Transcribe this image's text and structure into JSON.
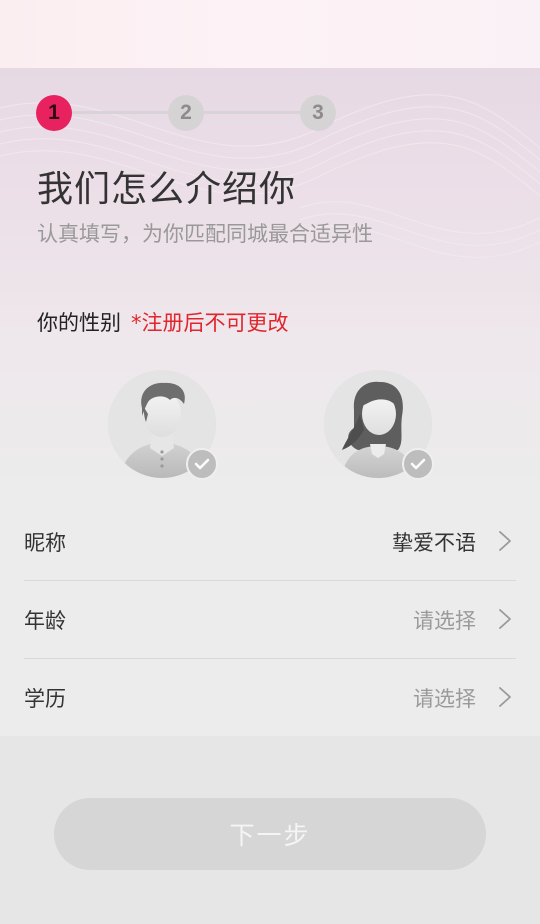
{
  "steps": [
    {
      "number": "1",
      "state": "active"
    },
    {
      "number": "2",
      "state": "inactive"
    },
    {
      "number": "3",
      "state": "inactive"
    }
  ],
  "header": {
    "title": "我们怎么介绍你",
    "subtitle": "认真填写，为你匹配同城最合适异性"
  },
  "gender": {
    "label": "你的性别",
    "note": "*注册后不可更改",
    "options": [
      {
        "name": "male",
        "icon": "male-avatar-icon",
        "selected": false
      },
      {
        "name": "female",
        "icon": "female-avatar-icon",
        "selected": false
      }
    ]
  },
  "form": {
    "rows": [
      {
        "label": "昵称",
        "value": "挚爱不语",
        "is_placeholder": false
      },
      {
        "label": "年龄",
        "value": "请选择",
        "is_placeholder": true
      },
      {
        "label": "学历",
        "value": "请选择",
        "is_placeholder": true
      }
    ]
  },
  "footer": {
    "next_label": "下一步",
    "enabled": false
  },
  "colors": {
    "accent": "#e7225e",
    "warning": "#e1252d",
    "step_inactive": "#d6d3d5",
    "button_disabled": "#d6d6d6"
  }
}
